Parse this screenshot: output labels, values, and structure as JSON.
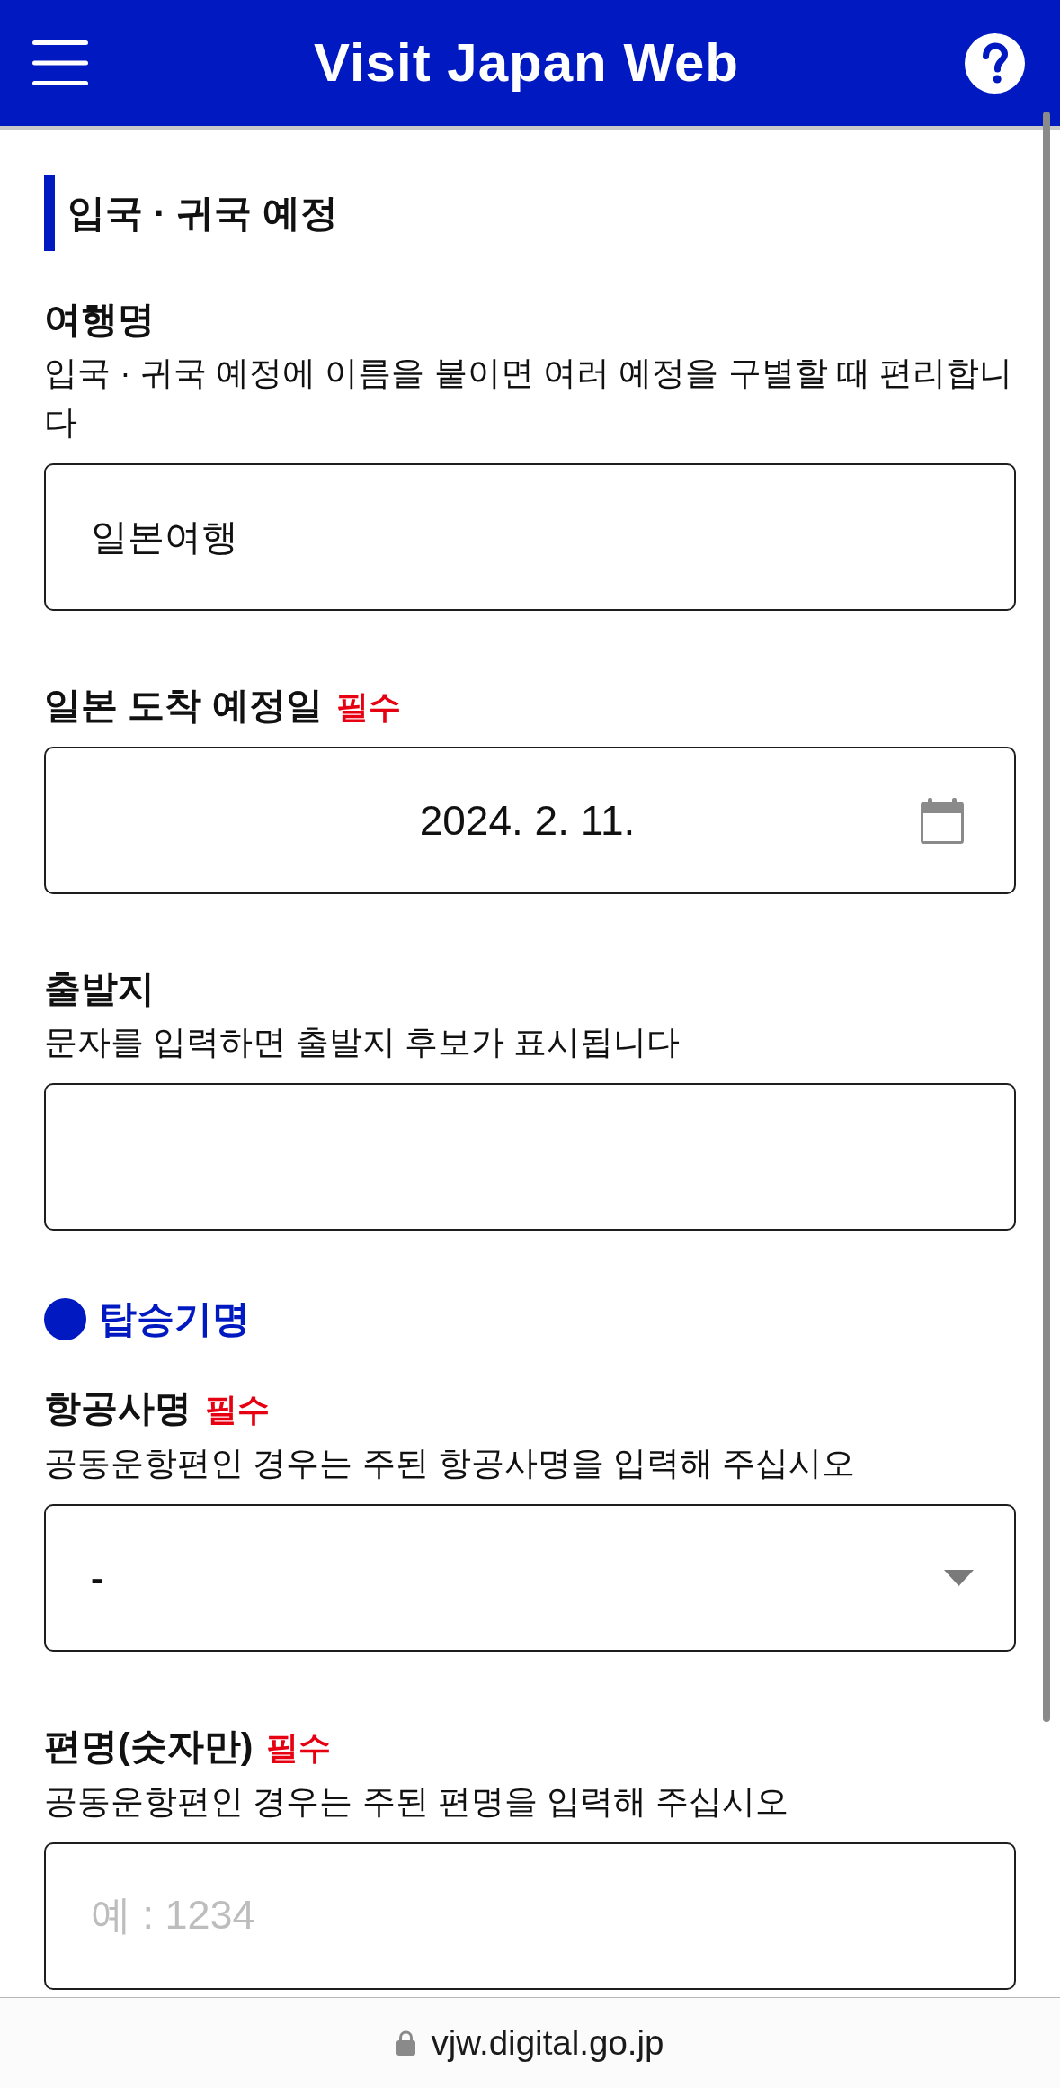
{
  "header": {
    "title": "Visit Japan Web"
  },
  "section": {
    "title": "입국 · 귀국 예정"
  },
  "items": [
    {
      "kind": "text",
      "label": "여행명",
      "hint": "입국 · 귀국 예정에 이름을 붙이면 여러 예정을 구별할 때 편리합니다",
      "value": "일본여행"
    },
    {
      "kind": "date",
      "label": "일본 도착 예정일",
      "required_mark": "필수",
      "value": "2024. 2. 11."
    },
    {
      "kind": "text",
      "label": "출발지",
      "hint": "문자를 입력하면 출발지 후보가 표시됩니다"
    },
    {
      "kind": "group_heading",
      "title": "탑승기명"
    },
    {
      "kind": "select",
      "label": "항공사명",
      "required_mark": "필수",
      "hint": "공동운항편인 경우는 주된 항공사명을 입력해 주십시오",
      "value": "-"
    },
    {
      "kind": "text",
      "label": "편명(숫자만)",
      "required_mark": "필수",
      "hint": "공동운항편인 경우는 주된 편명을 입력해 주십시오",
      "placeholder": "예 : 1234"
    }
  ],
  "address_bar": {
    "url": "vjw.digital.go.jp"
  }
}
